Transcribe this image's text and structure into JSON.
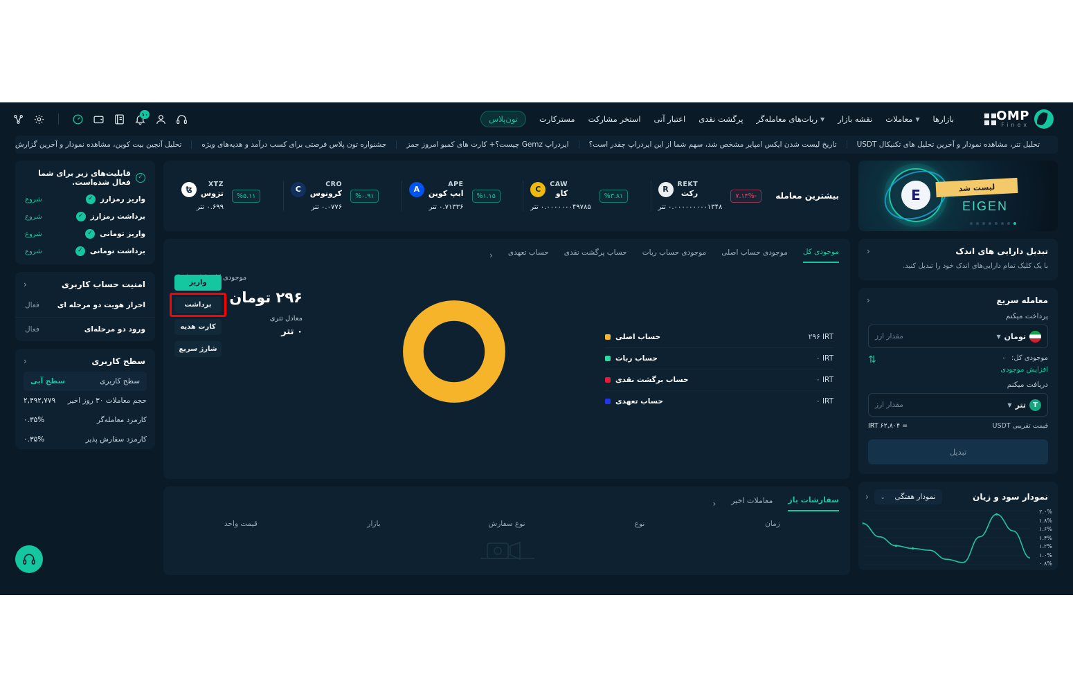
{
  "nav": {
    "logo_main": "OMP",
    "logo_sub": "Finex",
    "items": [
      {
        "label": "بازارها",
        "caret": false
      },
      {
        "label": "معاملات",
        "caret": true
      },
      {
        "label": "نقشه بازار",
        "caret": false
      },
      {
        "label": "ربات‌های معامله‌گر",
        "caret": true
      },
      {
        "label": "پرگشت نقدی",
        "caret": false
      },
      {
        "label": "اعتبار آنی",
        "caret": false
      },
      {
        "label": "استخر مشارکت",
        "caret": false
      },
      {
        "label": "مسترکارت",
        "caret": false
      }
    ],
    "pill": "تون‌پلاس",
    "icons": [
      {
        "name": "dashboard-icon"
      },
      {
        "name": "wallet-icon"
      },
      {
        "name": "orders-icon"
      },
      {
        "name": "notification-icon",
        "badge": "۱۰"
      },
      {
        "name": "user-icon"
      },
      {
        "name": "support-headset-icon"
      }
    ],
    "left_icons": [
      {
        "name": "network-icon"
      },
      {
        "name": "gear-icon"
      }
    ]
  },
  "ticker": {
    "items": [
      "تحلیل آنچین بیت کوین، مشاهده نمودار و آخرین گزارش گلس نود BTC",
      "جشنواره تون پلاس فرصتی برای کسب درآمد و هدیه‌های ویژه",
      "ایردراپ Gemz چیست؟+ کارت های کمبو امروز جمز",
      "تاریخ لیست شدن ایکس امپایر مشخص شد، سهم شما از این ایردراپ چقدر است؟",
      "تحلیل تتر، مشاهده نمودار و آخرین تحلیل های تکنیکال USDT"
    ]
  },
  "promo": {
    "badge": "لیست شد",
    "name": "EIGEN",
    "coin_glyph": "E"
  },
  "small_assets": {
    "title": "تبدیل دارایی های اندک",
    "subtitle": "با یک کلیک تمام دارایی‌های اندک خود را تبدیل کنید."
  },
  "quick_trade": {
    "title": "معامله سریع",
    "pay_label": "پرداخت میکنم",
    "pay_currency": "تومان",
    "pay_placeholder": "مقدار ارز",
    "balance_label": "موجودی کل:",
    "balance_value": "۰",
    "topup_link": "افزایش موجودی",
    "receive_label": "دریافت میکنم",
    "receive_currency": "تتر",
    "receive_currency_symbol": "T",
    "receive_placeholder": "مقدار ارز",
    "price_label": "قیمت تقریبی USDT",
    "price_value": "= ۶۲,۸۰۴ IRT",
    "submit": "تبدیل"
  },
  "markets": {
    "title": "بیشترین معامله",
    "unit": "تتر",
    "coins": [
      {
        "symbol": "REKT",
        "fa": "رکت",
        "price": "۰.۰۰۰۰۰۰۰۰۰۱۳۴۸ تتر",
        "change": "-۷.۱۴%",
        "dir": "down",
        "color": "#eceff1",
        "glyph": "R"
      },
      {
        "symbol": "CAW",
        "fa": "کاو",
        "price": "۰.۰۰۰۰۰۰۰۴۹۷۸۵ تتر",
        "change": "%۳.۸۱",
        "dir": "up",
        "color": "#f0b90b",
        "glyph": "C"
      },
      {
        "symbol": "APE",
        "fa": "ایپ کوین",
        "price": "۰.۷۱۳۳۶ تتر",
        "change": "%۱.۱۵",
        "dir": "up",
        "color": "#0054f0",
        "glyph": "A"
      },
      {
        "symbol": "CRO",
        "fa": "کرونوس",
        "price": "۰.۰۷۷۶ تتر",
        "change": "%۰.۹۱",
        "dir": "up",
        "color": "#12305e",
        "glyph": "C"
      },
      {
        "symbol": "XTZ",
        "fa": "تزوس",
        "price": "۰.۶۹۹ تتر",
        "change": "%۵.۱۱",
        "dir": "up",
        "color": "#ffffff",
        "glyph": "ꜩ"
      }
    ]
  },
  "balance": {
    "tabs": [
      {
        "label": "موجودی کل",
        "active": true
      },
      {
        "label": "موجودی حساب اصلی",
        "active": false
      },
      {
        "label": "موجودی حساب ربات",
        "active": false
      },
      {
        "label": "حساب پرگشت نقدی",
        "active": false
      },
      {
        "label": "حساب تعهدی",
        "active": false
      }
    ],
    "total_label": "موجودی کل دارایی‌ها",
    "total_value": "۲۹۶ تومان",
    "tether_label": "معادل تتری",
    "tether_value": "۰ تتر",
    "actions": [
      {
        "label": "واریز",
        "style": "primary",
        "highlight": false
      },
      {
        "label": "برداشت",
        "style": "ghost",
        "highlight": true
      },
      {
        "label": "کارت هدیه",
        "style": "ghost",
        "highlight": false
      },
      {
        "label": "شارژ سریع",
        "style": "ghost",
        "highlight": false
      }
    ],
    "legend": [
      {
        "name": "حساب اصلی",
        "value": "۲۹۶ IRT",
        "color": "#f5b429"
      },
      {
        "name": "حساب ربات",
        "value": "۰ IRT",
        "color": "#2fd9a0"
      },
      {
        "name": "حساب برگشت نقدی",
        "value": "۰ IRT",
        "color": "#e01d3c"
      },
      {
        "name": "حساب تعهدی",
        "value": "۰ IRT",
        "color": "#1f37e8"
      }
    ]
  },
  "chart_data": {
    "type": "line",
    "title": "نمودار سود و زیان",
    "selector": "نمودار هفتگی",
    "ylabel": "",
    "xlabel": "",
    "ytick_labels": [
      "۲.۰%",
      "۱.۸%",
      "۱.۶%",
      "۱.۴%",
      "۱.۲%",
      "۱.۰%",
      "۰.۸%"
    ],
    "ylim": [
      0.8,
      2.0
    ],
    "grid": true,
    "legend": "none",
    "series": [
      {
        "name": "سود و زیان",
        "color": "#21c79c",
        "x": [
          0,
          1,
          2,
          3,
          4,
          5,
          6,
          7,
          8,
          9,
          10
        ],
        "values": [
          1.72,
          1.42,
          1.22,
          1.16,
          1.12,
          0.92,
          0.85,
          1.42,
          1.92,
          1.55,
          0.95
        ]
      }
    ]
  },
  "orders": {
    "tabs": [
      {
        "label": "سفارشات باز",
        "active": true
      },
      {
        "label": "معاملات اخیر",
        "active": false
      }
    ],
    "columns": [
      "زمان",
      "نوع",
      "نوع سفارش",
      "بازار",
      "قیمت واحد"
    ],
    "rows": []
  },
  "capabilities": {
    "title": "قابلیت‌های زیر برای شما فعال شده‌است.",
    "items": [
      {
        "label": "واریز رمزارز",
        "action": "شروع"
      },
      {
        "label": "برداشت رمزارز",
        "action": "شروع"
      },
      {
        "label": "واریز تومانی",
        "action": "شروع"
      },
      {
        "label": "برداشت تومانی",
        "action": "شروع"
      }
    ]
  },
  "security": {
    "title": "امنیت حساب کاربری",
    "rows": [
      {
        "k": "احراز هویت دو مرحله ای",
        "v": "فعال"
      },
      {
        "k": "ورود دو مرحله‌ای",
        "v": "فعال"
      }
    ]
  },
  "user_level": {
    "title": "سطح کاربری",
    "level_key": "سطح کاربری",
    "level_value": "سطح آبی",
    "rows": [
      {
        "k": "حجم معاملات ۳۰ روز اخیر",
        "v": "۲,۴۹۲,۷۷۹"
      },
      {
        "k": "کارمزد معامله‌گر",
        "v": "۰.۳۵%"
      },
      {
        "k": "کارمزد سفارش پذیر",
        "v": "۰.۳۵%"
      }
    ]
  }
}
